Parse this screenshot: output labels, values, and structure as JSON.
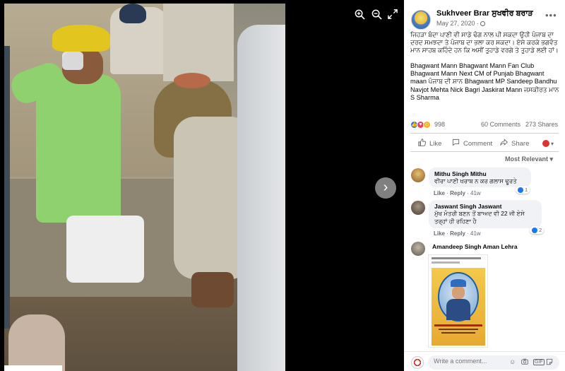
{
  "viewer": {
    "zoom_in_icon": "zoom-in-icon",
    "zoom_out_icon": "zoom-out-icon",
    "fullscreen_icon": "fullscreen-icon",
    "next_icon": "chevron-right-icon"
  },
  "post": {
    "author": "Sukhveer Brar ਸੁਖਵੀਰ ਬਰਾੜ",
    "date": "May 27, 2020 ·",
    "text": "ਜਿਹੜਾ ਬੰਦਾ ਪਾਣੀ ਵੀ ਸਾਡੇ ਢੰਗ ਨਾਲ ਪੀ ਸਕਦਾ ਉਹੀ ਪੰਜਾਬ ਦਾ ਦਰਦ ਸਮਝਦਾ ਤੇ ਪੰਜਾਬ ਦਾ ਭਲਾ ਕਰ ਸਕਦਾ। ਏਸੇ ਕਰਕੇ ਭਗਵੰਤ ਮਾਨ ਸਾਹਬ ਕਹਿੰਦੇ ਹਨ ਕਿ ਅਸੀਂ ਤੁਹਾਡੇ ਵਰਗੇ ਤੇ ਤੁਹਾਡੇ ਲਈ ਹਾਂ।",
    "tags": "Bhagwant Mann Bhagwant Mann Fan Club Bhagwant Mann Next CM of Punjab Bhagwant maan ਪੰਜਾਬ ਦੀ ਸ਼ਾਨ Bhagwant MP Sandeep Bandhu Navjot Mehta Nick Bagri Jaskirat Mann ਜਸਕੀਰਤ ਮਾਨ S Sharma",
    "reaction_count": "998",
    "comment_count": "60 Comments",
    "share_count": "273 Shares"
  },
  "actions": {
    "like": "Like",
    "comment": "Comment",
    "share": "Share",
    "audience": "▾"
  },
  "filter": {
    "label": "Most Relevant ▾"
  },
  "comments": [
    {
      "name": "Mithu Singh Mithu",
      "text": "ਵੀਰਾ ਪਾਣੀ ਖਰਾਬ ਨ ਕਰ ਗਲਾਸ ਢੂਰਤੇ",
      "like": "Like",
      "reply": "Reply",
      "age": "41w",
      "reactions": "1"
    },
    {
      "name": "Jaswant Singh Jaswant",
      "text": "ਮੁੱਖ ਮੰਤਰੀ ਬਣਨ ਤੋਂ ਬਾਅਦ ਵੀ 22 ਜੀ ਏਸੇ ਤਰ੍ਹਾਂ ਹੀ ਰਹਿਣਾ ਹੈ",
      "like": "Like",
      "reply": "Reply",
      "age": "41w",
      "reactions": "2"
    },
    {
      "name": "Amandeep Singh Aman Lehra"
    }
  ],
  "composer": {
    "placeholder": "Write a comment..."
  },
  "colors": {
    "accent": "#1877f2",
    "secondary_text": "#65676b",
    "bubble": "#f0f2f5"
  }
}
